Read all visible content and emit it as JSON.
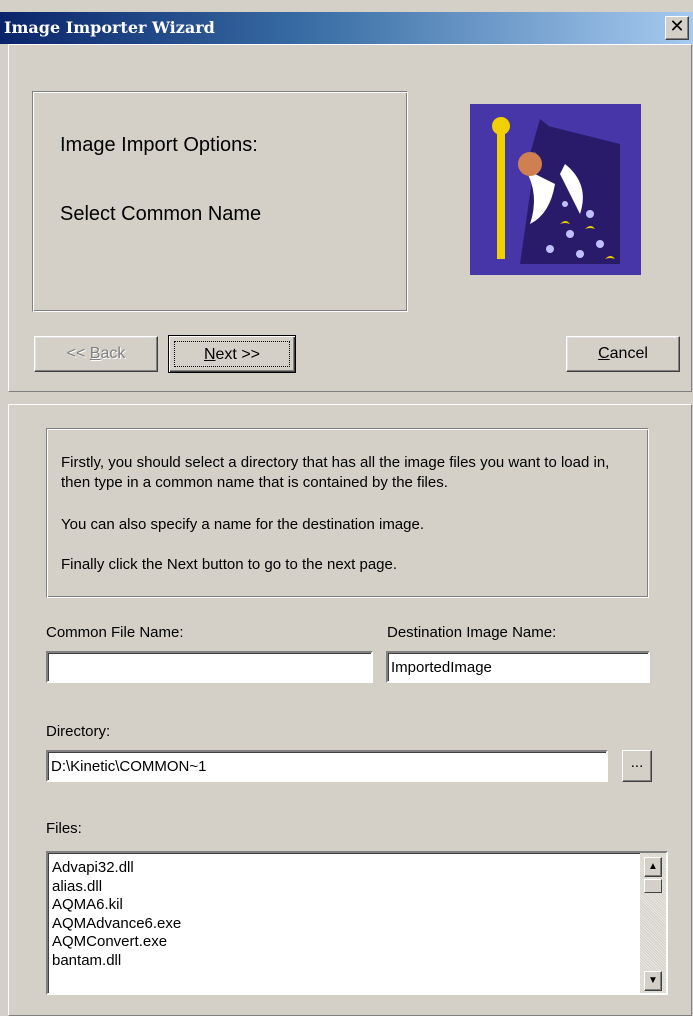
{
  "window": {
    "title": "Image Importer Wizard",
    "close_label": "✕"
  },
  "header": {
    "line1": "Image Import Options:",
    "line2": "Select Common Name"
  },
  "nav": {
    "back_pre": "<< ",
    "back_key": "B",
    "back_post": "ack",
    "next_key": "N",
    "next_post": "ext >>",
    "cancel_key": "C",
    "cancel_post": "ancel"
  },
  "description": {
    "p1": "Firstly, you should select a directory that has all the image files you want to load in, then type in a common name that is contained by the files.",
    "p2": "You can also specify a name for the destination image.",
    "p3": "Finally click the Next button to go to the next page."
  },
  "form": {
    "common_label": "Common File Name:",
    "common_value": "",
    "dest_label": "Destination Image Name:",
    "dest_value": "ImportedImage",
    "dir_label": "Directory:",
    "dir_value": "D:\\Kinetic\\COMMON~1",
    "browse_label": "...",
    "files_label": "Files:",
    "files": [
      "Advapi32.dll",
      "alias.dll",
      "AQMA6.kil",
      "AQMAdvance6.exe",
      "AQMConvert.exe",
      "bantam.dll"
    ]
  },
  "colors": {
    "wizard_bg": "#4636a8",
    "title_start": "#0a246a",
    "title_end": "#a6caf0"
  }
}
